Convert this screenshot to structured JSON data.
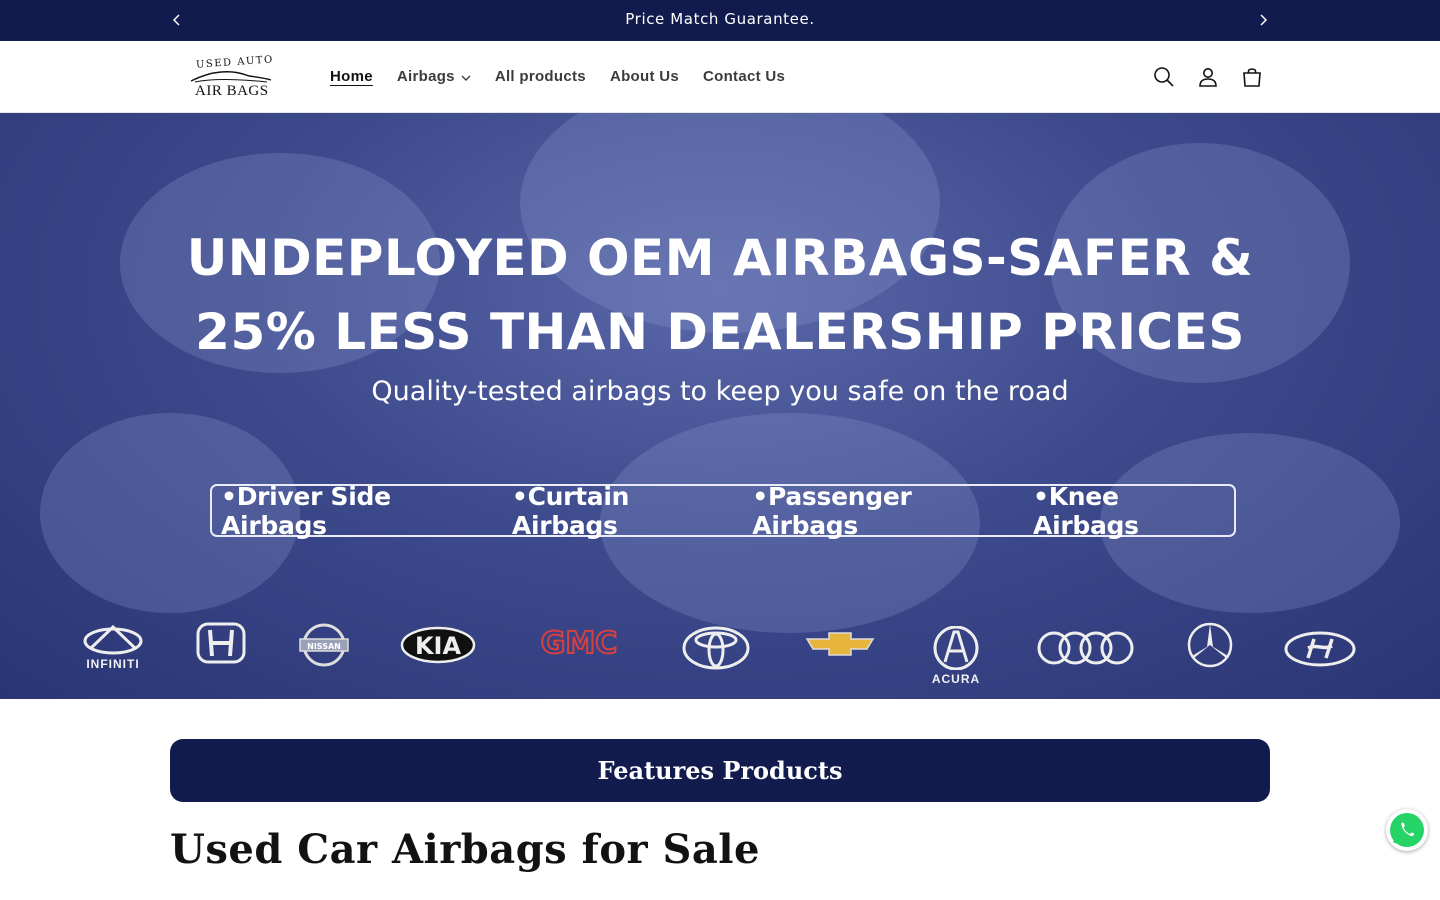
{
  "announcement": {
    "message": "Price Match Guarantee.",
    "prev_icon": "chevron-left-icon",
    "next_icon": "chevron-right-icon"
  },
  "header": {
    "logo": {
      "top_text": "USED AUTO",
      "bottom_text": "AIR BAGS"
    },
    "nav": [
      {
        "label": "Home",
        "active": true
      },
      {
        "label": "Airbags",
        "has_dropdown": true
      },
      {
        "label": "All products"
      },
      {
        "label": "About Us"
      },
      {
        "label": "Contact Us"
      }
    ],
    "icons": [
      "search-icon",
      "account-icon",
      "cart-icon"
    ]
  },
  "hero": {
    "headline_line1": "UNDEPLOYED OEM AIRBAGS-SAFER &",
    "headline_line2": "25% LESS THAN DEALERSHIP PRICES",
    "subheadline": "Quality-tested airbags to keep you safe on the road",
    "categories": [
      "Driver Side Airbags",
      "Curtain Airbags",
      "Passenger Airbags",
      "Knee Airbags"
    ],
    "brands": [
      "INFINITI",
      "Honda",
      "NISSAN",
      "KIA",
      "GMC",
      "Toyota",
      "Chevrolet",
      "ACURA",
      "Audi",
      "Mercedes-Benz",
      "Hyundai"
    ],
    "brand_labels": {
      "infiniti": "INFINITI",
      "nissan": "NISSAN",
      "kia": "KIA",
      "gmc": "GMC",
      "acura": "ACURA"
    }
  },
  "features_banner": {
    "label": "Features Products"
  },
  "section_title": "Used Car Airbags for Sale",
  "colors": {
    "navy": "#121b4e",
    "hero_blue": "#3d4a8c",
    "white": "#ffffff",
    "gmc_red": "#d8403f",
    "chevy_gold": "#e7b43c"
  }
}
